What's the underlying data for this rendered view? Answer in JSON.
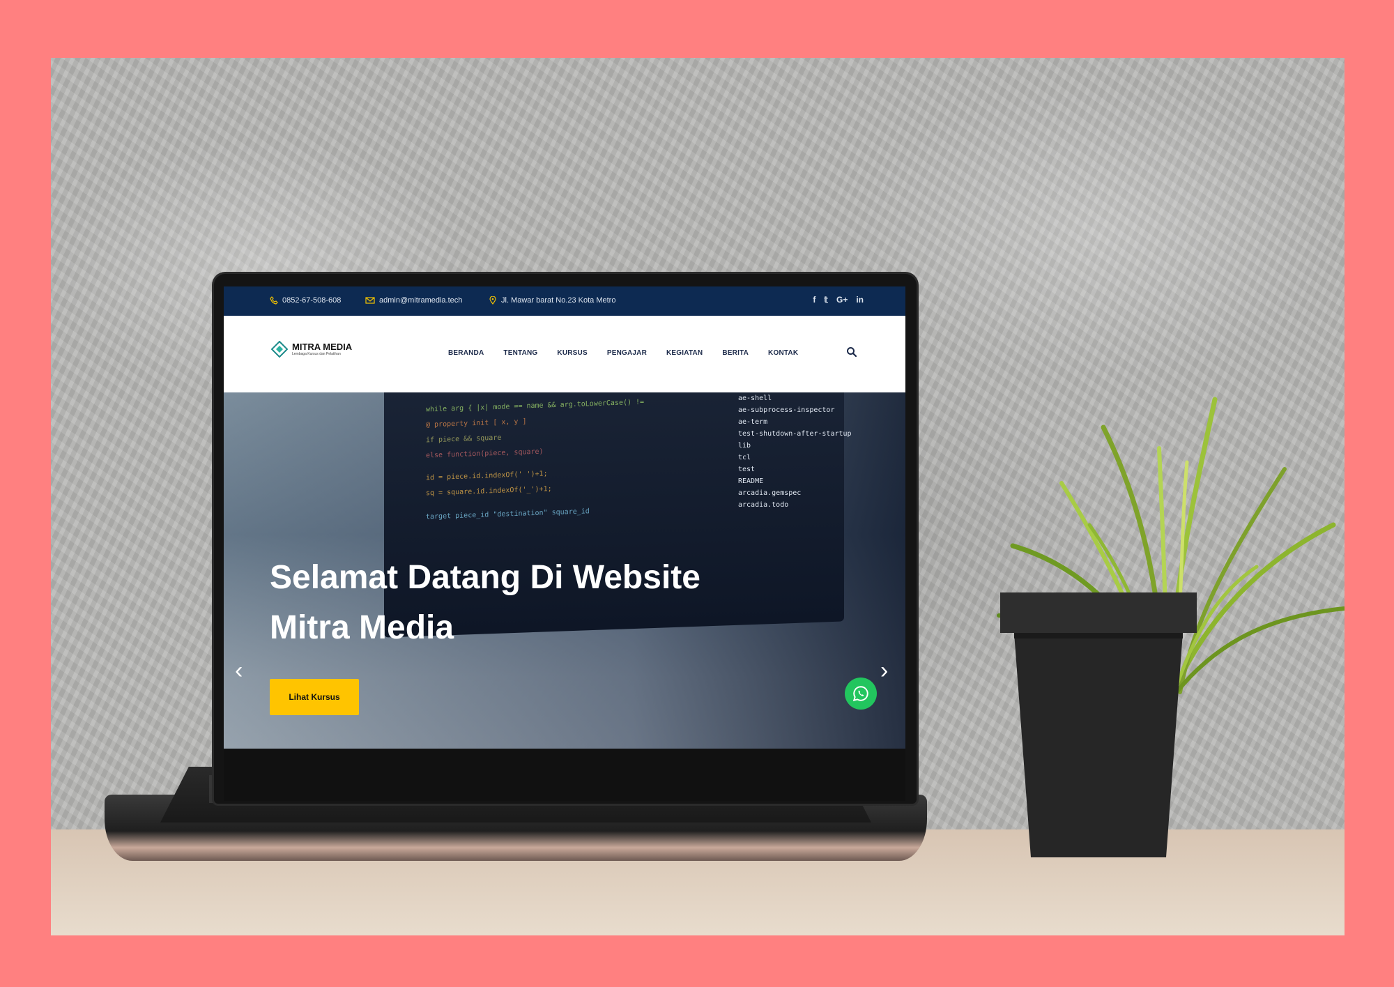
{
  "colors": {
    "background": "#ff8080",
    "topbar": "#0d2a52",
    "accent_yellow": "#ffc400",
    "whatsapp_green": "#22c55e"
  },
  "topbar": {
    "phone": "0852-67-508-608",
    "email": "admin@mitramedia.tech",
    "address": "Jl. Mawar barat No.23 Kota Metro",
    "social_icons": [
      "facebook-icon",
      "twitter-icon",
      "google-plus-icon",
      "linkedin-icon"
    ],
    "social_labels": [
      "f",
      "𝕥",
      "G+",
      "in"
    ]
  },
  "navbar": {
    "logo_title": "MITRA MEDIA",
    "logo_subtitle": "Lembaga Kursus dan Pelatihan",
    "menu": [
      "BERANDA",
      "TENTANG",
      "KURSUS",
      "PENGAJAR",
      "KEGIATAN",
      "BERITA",
      "KONTAK"
    ]
  },
  "hero": {
    "title_line1": "Selamat Datang Di Website",
    "title_line2": "Mitra Media",
    "cta_label": "Lihat Kursus",
    "prev_arrow": "‹",
    "next_arrow": "›"
  },
  "code_lines": [
    "ae-shell",
    "ae-subprocess-inspector",
    "ae-term",
    "test-shutdown-after-startup",
    "lib",
    "tcl",
    "test",
    "README",
    "arcadia.gemspec",
    "arcadia.todo"
  ]
}
